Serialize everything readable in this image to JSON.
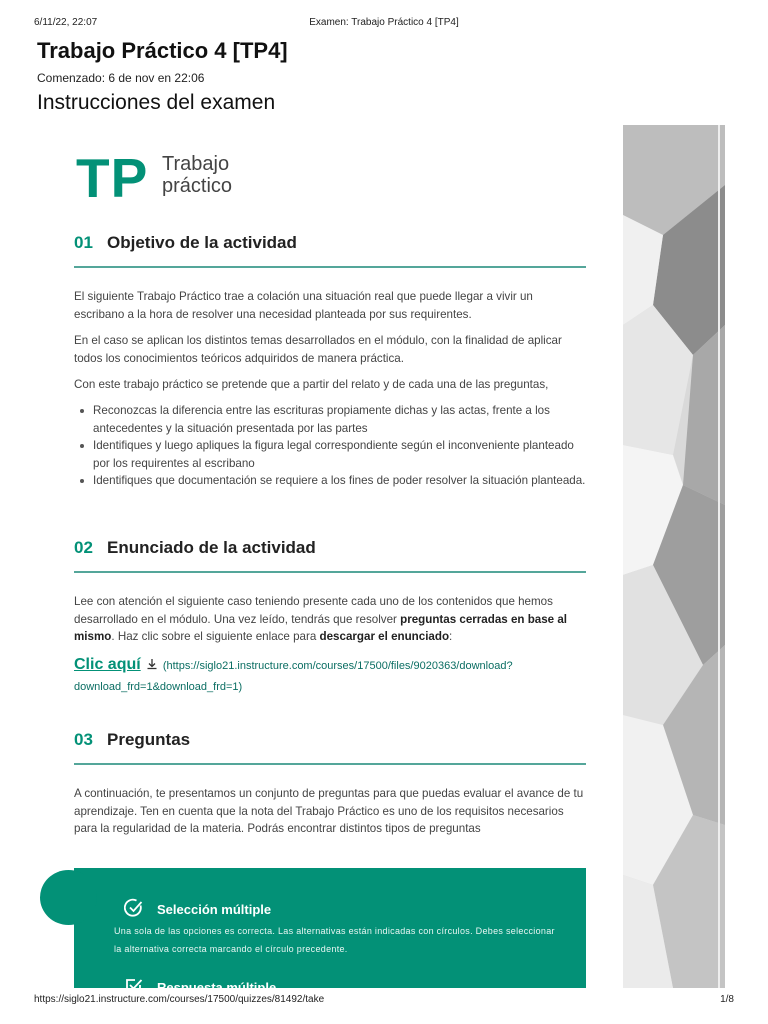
{
  "print_header": {
    "datetime": "6/11/22, 22:07",
    "page_title": "Examen: Trabajo Práctico 4 [TP4]"
  },
  "quiz": {
    "title": "Trabajo Práctico 4 [TP4]",
    "started": "Comenzado: 6 de nov en 22:06",
    "instructions_title": "Instrucciones del examen"
  },
  "logo": {
    "big": "TP",
    "line1": "Trabajo",
    "line2": "práctico"
  },
  "sections": [
    {
      "number": "01",
      "title": "Objetivo de la actividad",
      "paragraphs": [
        "El siguiente Trabajo Práctico trae a colación una situación real que puede llegar a vivir un escribano a la hora de resolver una necesidad planteada por sus requirentes.",
        "En el caso se aplican los distintos temas desarrollados en el módulo, con la finalidad de aplicar todos los conocimientos teóricos adquiridos de manera práctica.",
        "Con este trabajo práctico se pretende que a partir del relato y de cada una de las preguntas,"
      ],
      "bullets": [
        "Reconozcas la diferencia entre las escrituras propiamente dichas y las actas, frente a los antecedentes y la situación presentada por las partes",
        "Identifiques y luego apliques la figura legal correspondiente según el inconveniente planteado por los requirentes al escribano",
        "Identifiques que documentación se requiere a los fines de poder resolver la situación planteada."
      ]
    },
    {
      "number": "02",
      "title": "Enunciado de la actividad",
      "text_1": "Lee con atención el siguiente caso teniendo presente cada uno de los contenidos que hemos desarrollado en el módulo. Una vez leído, tendrás que resolver ",
      "bold_1": "preguntas cerradas en base al mismo",
      "text_2": ". Haz clic sobre el siguiente enlace para ",
      "bold_2": "descargar el enunciado",
      "text_3": ":",
      "link_label": "Clic aquí",
      "link_url": "(https://siglo21.instructure.com/courses/17500/files/9020363/download?download_frd=1&download_frd=1)"
    },
    {
      "number": "03",
      "title": "Preguntas",
      "paragraph": "A continuación, te presentamos un conjunto de preguntas para que puedas evaluar el avance de tu aprendizaje. Ten en cuenta que la nota del Trabajo Práctico es uno de los requisitos necesarios para la regularidad de la materia. Podrás encontrar distintos tipos de preguntas"
    }
  ],
  "question_types": [
    {
      "title": "Selección múltiple",
      "description": "Una sola de las opciones es correcta. Las alternativas están indicadas con círculos. Debes seleccionar la alternativa correcta marcando el círculo precedente."
    },
    {
      "title": "Respuesta múltiple"
    }
  ],
  "print_footer": {
    "url": "https://siglo21.instructure.com/courses/17500/quizzes/81492/take",
    "page": "1/8"
  },
  "colors": {
    "accent": "#039177",
    "rule": "#54a69a"
  }
}
